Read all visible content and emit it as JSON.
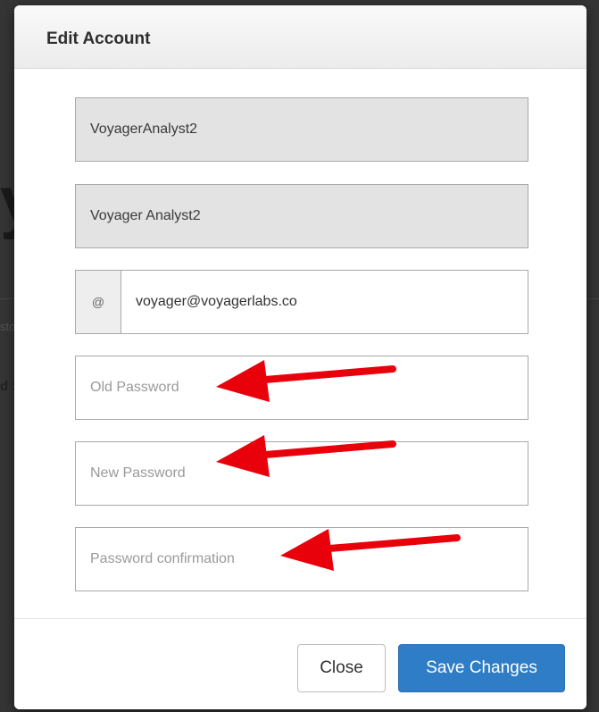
{
  "background": {
    "heading_fragment": "y",
    "text_fragment_1": "sto",
    "text_fragment_2": "d S"
  },
  "modal": {
    "title": "Edit Account",
    "username_value": "VoyagerAnalyst2",
    "fullname_value": "Voyager Analyst2",
    "email_addon": "@",
    "email_value": "voyager@voyagerlabs.co",
    "old_password_placeholder": "Old Password",
    "new_password_placeholder": "New Password",
    "password_confirmation_placeholder": "Password confirmation",
    "close_label": "Close",
    "save_label": "Save Changes"
  },
  "colors": {
    "annotation_arrow": "#e8000b",
    "primary_button": "#2e7dc6",
    "readonly_field": "#e3e3e3"
  }
}
